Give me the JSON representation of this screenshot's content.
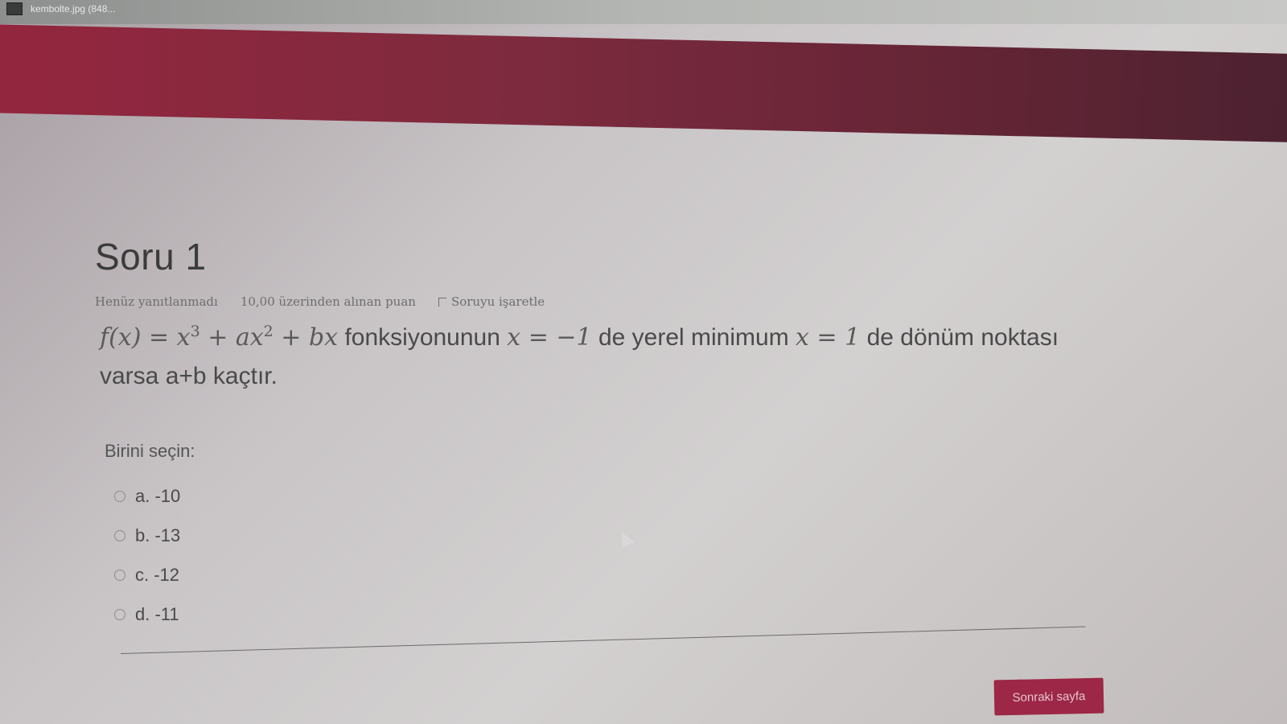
{
  "window": {
    "file_tab_label": "kembolte.jpg (848..."
  },
  "question": {
    "title": "Soru 1",
    "status": "Henüz yanıtlanmadı",
    "points": "10,00 üzerinden alınan puan",
    "flag_label": "Soruyu işaretle",
    "text_parts": {
      "func": "f(x) = x",
      "exp3": "3",
      "plus_ax": " + ax",
      "exp2": "2",
      "plus_bx": " + bx",
      "t1": " fonksiyonunun ",
      "m1": "x = −1",
      "t2": " de yerel minimum ",
      "m2": "x = 1",
      "t3": " de dönüm noktası varsa a+b kaçtır."
    },
    "choose_label": "Birini seçin:",
    "options": [
      {
        "label": "a. -10"
      },
      {
        "label": "b. -13"
      },
      {
        "label": "c. -12"
      },
      {
        "label": "d. -11"
      }
    ]
  },
  "navigation": {
    "next_button": "Sonraki sayfa"
  },
  "colors": {
    "accent": "#9c2746",
    "header": "#7e2a3e"
  }
}
